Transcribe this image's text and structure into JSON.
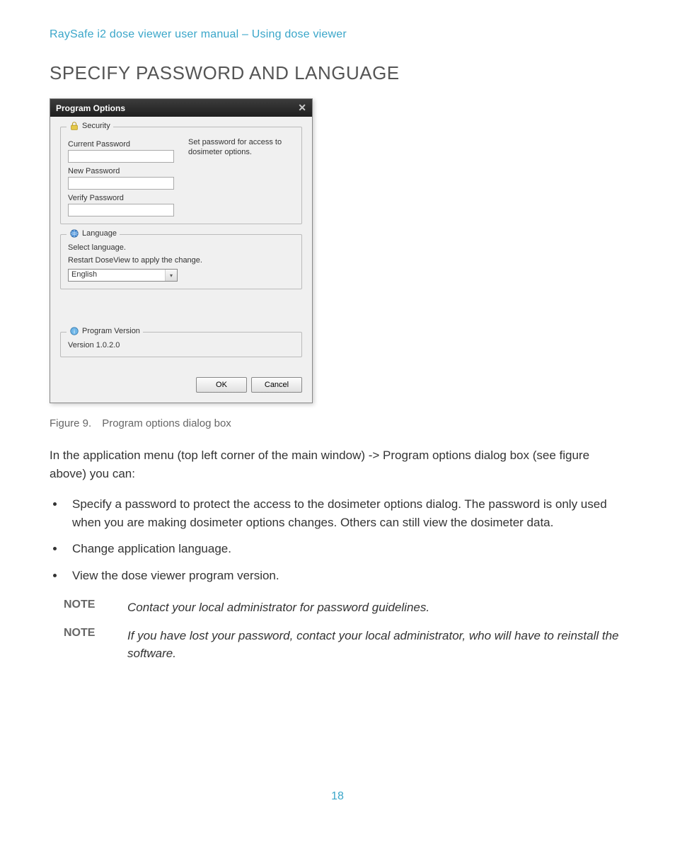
{
  "header": {
    "breadcrumb": "RaySafe i2 dose viewer user manual – Using dose viewer"
  },
  "section": {
    "title": "SPECIFY PASSWORD AND LANGUAGE"
  },
  "dialog": {
    "title": "Program Options",
    "security": {
      "legend": "Security",
      "current_pw_label": "Current Password",
      "new_pw_label": "New Password",
      "verify_pw_label": "Verify Password",
      "helper": "Set password for access to dosimeter options."
    },
    "language": {
      "legend": "Language",
      "select_text": "Select language.",
      "restart_text": "Restart DoseView to apply the change.",
      "selected": "English"
    },
    "version": {
      "legend": "Program Version",
      "value": "Version 1.0.2.0"
    },
    "buttons": {
      "ok": "OK",
      "cancel": "Cancel"
    }
  },
  "figure": {
    "caption": "Figure 9. Program options dialog box"
  },
  "body": {
    "intro": "In the application menu (top left corner of the main window) -> Program options dialog box (see figure above) you can:",
    "bullets": [
      "Specify a password to protect the access to the dosimeter options dialog. The password is only used when you are making dosimeter options changes. Others can still view the dosimeter data.",
      "Change application language.",
      "View the dose viewer program version."
    ],
    "notes": [
      {
        "label": "NOTE",
        "text": "Contact your local administrator for password guidelines."
      },
      {
        "label": "NOTE",
        "text": "If you have lost your password, contact your local administrator, who will have to reinstall the software."
      }
    ]
  },
  "page_number": "18"
}
